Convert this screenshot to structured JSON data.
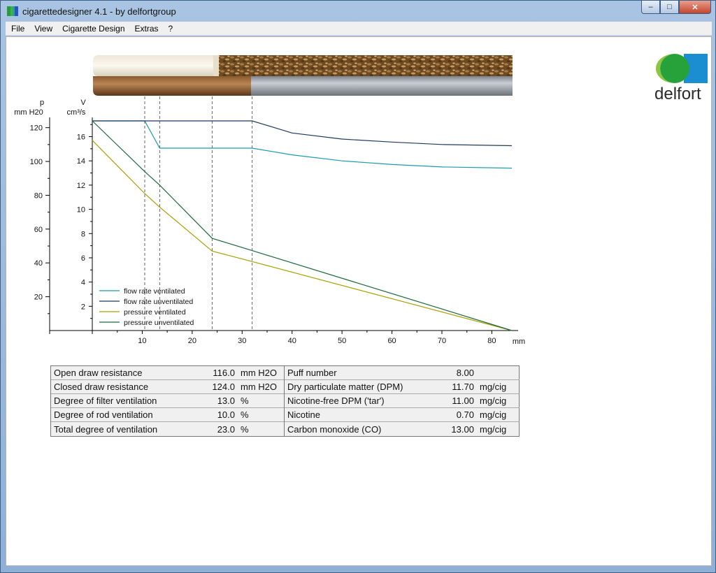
{
  "window": {
    "title": "cigarettedesigner 4.1 - by delfortgroup",
    "min_symbol": "–",
    "max_symbol": "□",
    "close_symbol": "✕"
  },
  "menu": [
    "File",
    "View",
    "Cigarette Design",
    "Extras",
    "?"
  ],
  "logo": {
    "text": "delfort",
    "colors": [
      "#8cc63e",
      "#27a23b",
      "#1a8ed0"
    ]
  },
  "chart_data": {
    "type": "line",
    "xlabel": "mm",
    "xlim": [
      0,
      84
    ],
    "x_ticks": [
      10,
      20,
      30,
      40,
      50,
      60,
      70,
      80
    ],
    "left_axis": {
      "title": "p",
      "unit": "mm H20",
      "ticks": [
        20,
        40,
        60,
        80,
        100,
        120
      ],
      "range": [
        0,
        124
      ]
    },
    "right_axis": {
      "title": "V",
      "unit": "cm³/s",
      "ticks": [
        2,
        4,
        6,
        8,
        10,
        12,
        14,
        16
      ],
      "range": [
        0,
        17.3
      ]
    },
    "markers_mm": [
      10.5,
      13.5,
      24,
      32
    ],
    "series": [
      {
        "name": "flow rate ventilated",
        "axis": "right",
        "color": "#1a9bb0",
        "points": [
          [
            0,
            17.3
          ],
          [
            10.5,
            17.3
          ],
          [
            13.5,
            15.05
          ],
          [
            32,
            15.05
          ],
          [
            40,
            14.5
          ],
          [
            50,
            14.0
          ],
          [
            60,
            13.7
          ],
          [
            70,
            13.5
          ],
          [
            84,
            13.4
          ]
        ]
      },
      {
        "name": "flow rate unventilated",
        "axis": "right",
        "color": "#1f3a60",
        "points": [
          [
            0,
            17.3
          ],
          [
            32,
            17.3
          ],
          [
            40,
            16.3
          ],
          [
            50,
            15.8
          ],
          [
            60,
            15.55
          ],
          [
            70,
            15.35
          ],
          [
            84,
            15.25
          ]
        ]
      },
      {
        "name": "pressure ventilated",
        "axis": "left",
        "color": "#a8a000",
        "points": [
          [
            0,
            112.5
          ],
          [
            10.5,
            81
          ],
          [
            13.5,
            73
          ],
          [
            24,
            47
          ],
          [
            32,
            40.8
          ],
          [
            84,
            0
          ]
        ]
      },
      {
        "name": "pressure unventilated",
        "axis": "left",
        "color": "#1c6a3c",
        "points": [
          [
            0,
            124
          ],
          [
            10.5,
            94
          ],
          [
            13.5,
            86
          ],
          [
            24,
            54.5
          ],
          [
            32,
            47.3
          ],
          [
            84,
            0
          ]
        ]
      }
    ]
  },
  "results": {
    "left": [
      {
        "label": "Open draw resistance",
        "value": "116.0",
        "unit": "mm H2O"
      },
      {
        "label": "Closed draw resistance",
        "value": "124.0",
        "unit": "mm H2O"
      },
      {
        "label": "Degree of filter ventilation",
        "value": "13.0",
        "unit": "%"
      },
      {
        "label": "Degree of rod ventilation",
        "value": "10.0",
        "unit": "%"
      },
      {
        "label": "Total degree of ventilation",
        "value": "23.0",
        "unit": "%"
      }
    ],
    "right": [
      {
        "label": "Puff number",
        "value": "8.00",
        "unit": ""
      },
      {
        "label": "Dry particulate matter (DPM)",
        "value": "11.70",
        "unit": "mg/cig"
      },
      {
        "label": "Nicotine-free DPM ('tar')",
        "value": "11.00",
        "unit": "mg/cig"
      },
      {
        "label": "Nicotine",
        "value": "0.70",
        "unit": "mg/cig"
      },
      {
        "label": "Carbon monoxide (CO)",
        "value": "13.00",
        "unit": "mg/cig"
      }
    ]
  }
}
